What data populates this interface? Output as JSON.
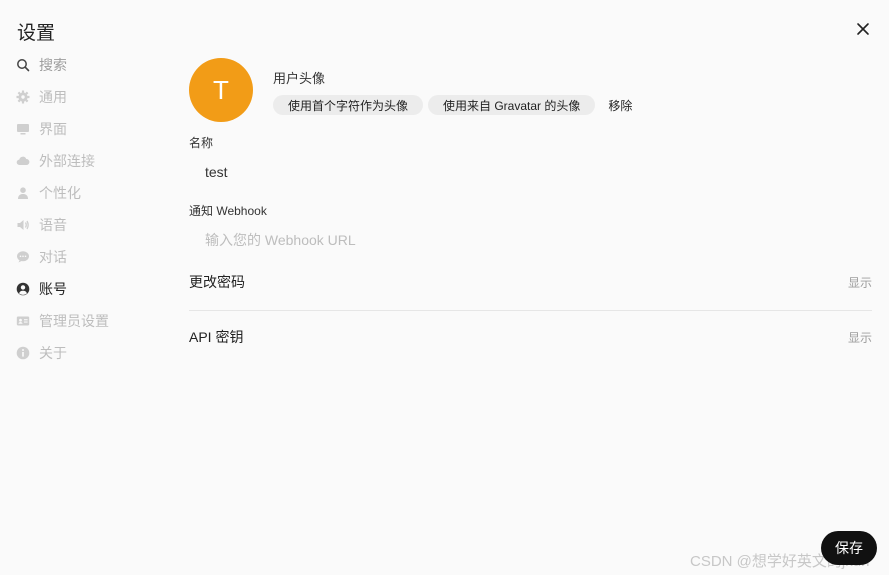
{
  "dialog": {
    "title": "设置"
  },
  "sidebar": {
    "items": [
      {
        "label": "搜索",
        "icon": "search-icon"
      },
      {
        "label": "通用",
        "icon": "gear-icon"
      },
      {
        "label": "界面",
        "icon": "monitor-icon"
      },
      {
        "label": "外部连接",
        "icon": "cloud-icon"
      },
      {
        "label": "个性化",
        "icon": "user-icon"
      },
      {
        "label": "语音",
        "icon": "speaker-icon"
      },
      {
        "label": "对话",
        "icon": "chat-bubble-icon"
      },
      {
        "label": "账号",
        "icon": "account-circle-icon"
      },
      {
        "label": "管理员设置",
        "icon": "id-card-icon"
      },
      {
        "label": "关于",
        "icon": "info-icon"
      }
    ]
  },
  "account": {
    "avatar_letter": "T",
    "avatar_color": "#f29c17",
    "avatar_label": "用户头像",
    "btn_initials": "使用首个字符作为头像",
    "btn_gravatar": "使用来自 Gravatar 的头像",
    "btn_remove": "移除",
    "name_label": "名称",
    "name_value": "test",
    "webhook_label": "通知 Webhook",
    "webhook_placeholder": "输入您的 Webhook URL",
    "change_password": "更改密码",
    "change_password_toggle": "显示",
    "api_key": "API 密钥",
    "api_key_toggle": "显示"
  },
  "footer": {
    "save_label": "保存"
  },
  "watermark": "CSDN @想学好英文的jkun"
}
